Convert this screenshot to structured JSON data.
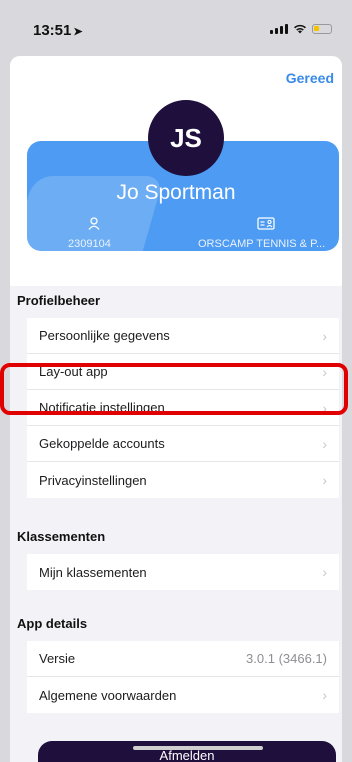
{
  "status": {
    "time": "13:51"
  },
  "header": {
    "done_label": "Gereed"
  },
  "profile": {
    "initials": "JS",
    "name": "Jo Sportman",
    "member_number": "2309104",
    "club": "ORSCAMP TENNIS & P..."
  },
  "sections": {
    "profile_management": {
      "title": "Profielbeheer",
      "items": [
        {
          "label": "Persoonlijke gegevens"
        },
        {
          "label": "Lay-out app"
        },
        {
          "label": "Notificatie instellingen"
        },
        {
          "label": "Gekoppelde accounts"
        },
        {
          "label": "Privacyinstellingen"
        }
      ]
    },
    "rankings": {
      "title": "Klassementen",
      "items": [
        {
          "label": "Mijn klassementen"
        }
      ]
    },
    "app_details": {
      "title": "App details",
      "version_label": "Versie",
      "version_value": "3.0.1 (3466.1)",
      "terms_label": "Algemene voorwaarden"
    }
  },
  "logout_label": "Afmelden",
  "colors": {
    "accent": "#3a8be8",
    "card": "#4d9bf2",
    "primary_dark": "#1e0f3d",
    "highlight": "#e00000"
  },
  "icons": [
    "navigation-arrow-icon",
    "signal-icon",
    "wifi-icon",
    "battery-icon",
    "person-icon",
    "id-card-icon",
    "chevron-right-icon"
  ]
}
